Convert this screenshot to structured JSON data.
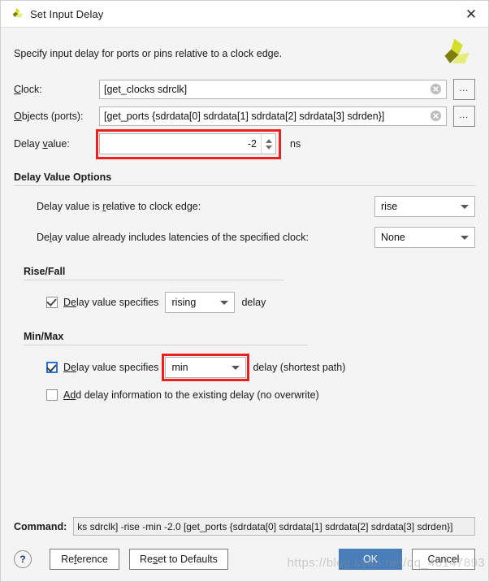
{
  "window": {
    "title": "Set Input Delay",
    "app_icon": "vivado-logo-icon",
    "close_label": "✕"
  },
  "header": {
    "description": "Specify input delay for ports or pins relative to a clock edge.",
    "logo": "vivado-logo-icon"
  },
  "fields": {
    "clock": {
      "label": "Clock:",
      "label_prefix": "C",
      "label_rest": "lock:",
      "value": "[get_clocks sdrclk]",
      "clear_icon": "clear-circle-icon",
      "browse_label": "…"
    },
    "objects": {
      "label": "Objects (ports):",
      "label_prefix": "O",
      "label_rest": "bjects (ports):",
      "value": "[get_ports {sdrdata[0] sdrdata[1] sdrdata[2] sdrdata[3] sdrden}]",
      "clear_icon": "clear-circle-icon",
      "browse_label": "…"
    },
    "delay_value": {
      "label_a": "Delay ",
      "label_b": "v",
      "label_c": "alue:",
      "value": "-2",
      "unit": "ns",
      "highlighted": true
    }
  },
  "delay_value_options": {
    "title": "Delay Value Options",
    "relative_to_edge": {
      "label_a": "Delay value is ",
      "label_b": "r",
      "label_c": "elative to clock edge:",
      "selected": "rise"
    },
    "includes_latencies": {
      "label_a": "De",
      "label_b": "l",
      "label_c": "ay value already includes latencies of the specified clock:",
      "selected": "None"
    }
  },
  "rise_fall": {
    "title": "Rise/Fall",
    "checkbox": {
      "checked": true,
      "label_a": "D",
      "label_b": "e",
      "label_c": "lay value specifies",
      "selected": "rising",
      "suffix": "delay"
    }
  },
  "min_max": {
    "title": "Min/Max",
    "checkbox": {
      "checked": true,
      "accent": true,
      "label_a": "D",
      "label_b": "e",
      "label_c": "lay value specifies",
      "selected": "min",
      "suffix": "delay (shortest path)",
      "highlighted": true
    },
    "add_delay": {
      "checked": false,
      "label_a": "A",
      "label_b": "d",
      "label_c": "d delay information to the existing delay (no overwrite)"
    }
  },
  "command": {
    "label": "Command:",
    "value": "ks sdrclk] -rise -min -2.0 [get_ports {sdrdata[0] sdrdata[1] sdrdata[2] sdrdata[3] sdrden}]"
  },
  "buttons": {
    "help": "?",
    "reference_a": "Re",
    "reference_b": "f",
    "reference_c": "erence",
    "reset_a": "Re",
    "reset_b": "s",
    "reset_c": "et to Defaults",
    "ok": "OK",
    "cancel": "Cancel"
  },
  "watermark": "https://blog.csdn.net/qq_40147893",
  "colors": {
    "accent_blue": "#4a7ebb",
    "highlight_red": "#f01e1e",
    "checkbox_accent": "#2a6fd6",
    "dialog_bg": "#f4f4f4"
  }
}
